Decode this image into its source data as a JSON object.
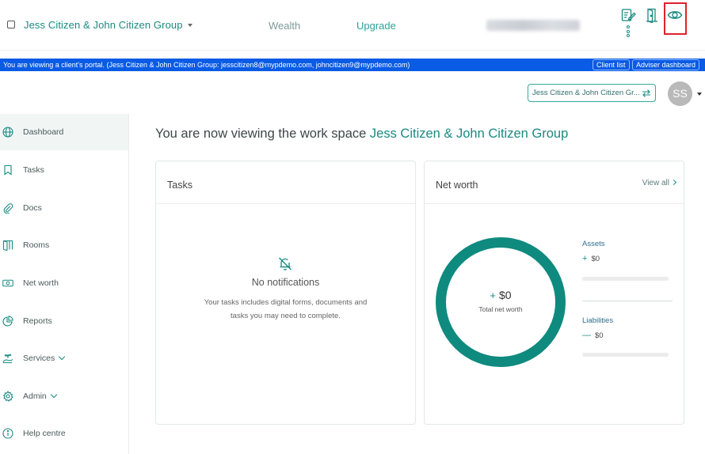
{
  "header": {
    "group_name": "Jess Citizen & John Citizen Group",
    "nav": {
      "wealth": "Wealth",
      "upgrade": "Upgrade"
    },
    "icons": [
      "edit-form-icon",
      "door-exit-icon",
      "eye-icon",
      "more-dots-icon"
    ]
  },
  "banner": {
    "text": "You are viewing a client's portal. (Jess Citizen & John Citizen Group:  jesscitizen8@mypdemo.com, johncitizen9@mypdemo.com)",
    "client_list": "Client list",
    "adviser_dashboard": "Adviser dashboard",
    "color": "#0a5be5"
  },
  "group_selector": {
    "value": "Jess Citizen & John Citizen Gr..."
  },
  "avatar": {
    "initials": "SS"
  },
  "sidebar": {
    "items": [
      {
        "label": "Dashboard",
        "icon": "globe-icon",
        "active": true
      },
      {
        "label": "Tasks",
        "icon": "bookmark-icon"
      },
      {
        "label": "Docs",
        "icon": "paperclip-icon"
      },
      {
        "label": "Rooms",
        "icon": "book-icon"
      },
      {
        "label": "Net worth",
        "icon": "money-icon"
      },
      {
        "label": "Reports",
        "icon": "pie-chart-icon"
      },
      {
        "label": "Services",
        "icon": "hand-plant-icon"
      },
      {
        "label": "Admin",
        "icon": "gear-icon"
      },
      {
        "label": "Help centre",
        "icon": "info-icon"
      }
    ]
  },
  "main": {
    "title_prefix": "You are now viewing the work space",
    "title_group": "Jess Citizen & John Citizen Group",
    "tasks_card": {
      "title": "Tasks",
      "empty_title": "No notifications",
      "empty_desc": "Your tasks includes digital forms, documents and tasks you may need to complete."
    },
    "networth_card": {
      "title": "Net worth",
      "view_all": "View all",
      "total_symbol": "+",
      "total_value": "$0",
      "total_label": "Total net worth",
      "assets_label": "Assets",
      "assets_symbol": "+",
      "assets_value": "$0",
      "liabilities_label": "Liabilities",
      "liabilities_symbol": "—",
      "liabilities_value": "$0",
      "accent_color": "#0f8a7f"
    }
  }
}
